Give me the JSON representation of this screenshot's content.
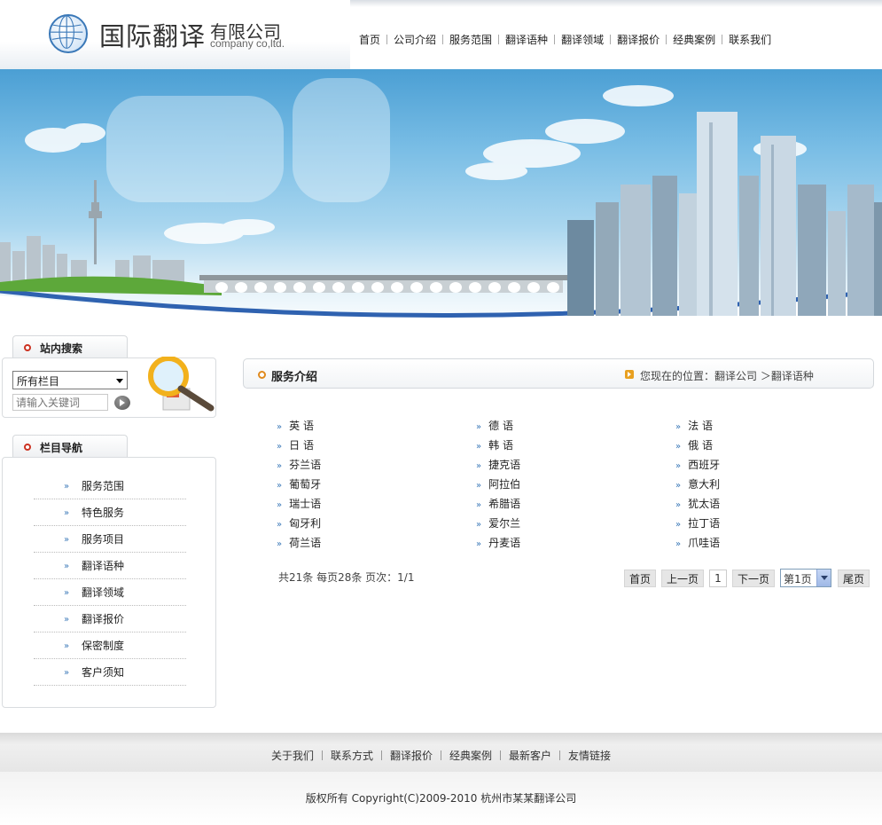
{
  "brand": {
    "name_cn": "国际翻译",
    "suffix_cn": "有限公司",
    "name_en": "company co,ltd.",
    "accent": "#3a78b8"
  },
  "nav": [
    "首页",
    "公司介绍",
    "服务范围",
    "翻译语种",
    "翻译领域",
    "翻译报价",
    "经典案例",
    "联系我们"
  ],
  "search": {
    "title": "站内搜索",
    "select_value": "所有栏目",
    "placeholder": "请输入关键词"
  },
  "side_nav": {
    "title": "栏目导航",
    "items": [
      "服务范围",
      "特色服务",
      "服务项目",
      "翻译语种",
      "翻译领域",
      "翻译报价",
      "保密制度",
      "客户须知"
    ]
  },
  "main": {
    "title": "服务介绍",
    "breadcrumb": "您现在的位置：翻译公司 ＞翻译语种",
    "languages": [
      [
        "英 语",
        "德 语",
        "法 语"
      ],
      [
        "日 语",
        "韩 语",
        "俄 语"
      ],
      [
        "芬兰语",
        "捷克语",
        "西班牙"
      ],
      [
        "葡萄牙",
        "阿拉伯",
        "意大利"
      ],
      [
        "瑞士语",
        "希腊语",
        "犹太语"
      ],
      [
        "匈牙利",
        "爱尔兰",
        "拉丁语"
      ],
      [
        "荷兰语",
        "丹麦语",
        "爪哇语"
      ]
    ]
  },
  "pager": {
    "info": "共21条  每页28条  页次：1/1",
    "first": "首页",
    "prev": "上一页",
    "current": "1",
    "next": "下一页",
    "select": "第1页",
    "last": "尾页"
  },
  "footer": {
    "links": [
      "关于我们",
      "联系方式",
      "翻译报价",
      "经典案例",
      "最新客户",
      "友情链接"
    ],
    "copyright": "版权所有  Copyright(C)2009-2010 杭州市某某翻译公司"
  }
}
